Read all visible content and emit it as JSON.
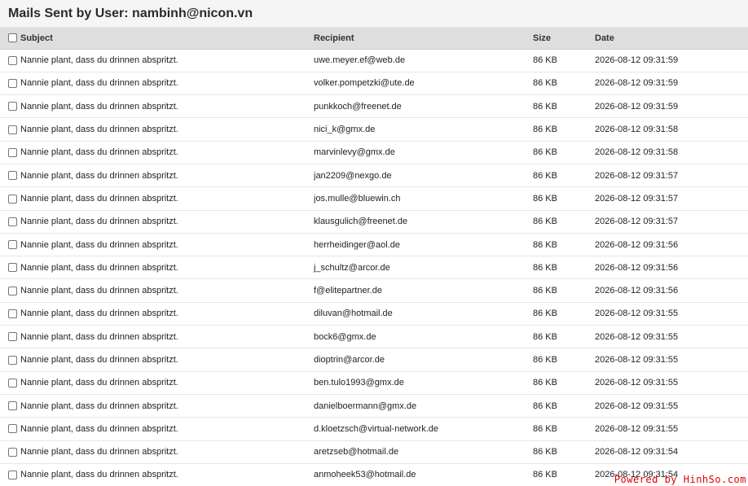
{
  "page": {
    "title": "Mails Sent by User: nambinh@nicon.vn"
  },
  "table": {
    "headers": {
      "subject": "Subject",
      "recipient": "Recipient",
      "size": "Size",
      "date": "Date"
    },
    "rows": [
      {
        "subject": "Nannie plant, dass du drinnen abspritzt.",
        "recipient": "uwe.meyer.ef@web.de",
        "size": "86 KB",
        "date": "2026-08-12 09:31:59"
      },
      {
        "subject": "Nannie plant, dass du drinnen abspritzt.",
        "recipient": "volker.pompetzki@ute.de",
        "size": "86 KB",
        "date": "2026-08-12 09:31:59"
      },
      {
        "subject": "Nannie plant, dass du drinnen abspritzt.",
        "recipient": "punkkoch@freenet.de",
        "size": "86 KB",
        "date": "2026-08-12 09:31:59"
      },
      {
        "subject": "Nannie plant, dass du drinnen abspritzt.",
        "recipient": "nici_k@gmx.de",
        "size": "86 KB",
        "date": "2026-08-12 09:31:58"
      },
      {
        "subject": "Nannie plant, dass du drinnen abspritzt.",
        "recipient": "marvinlevy@gmx.de",
        "size": "86 KB",
        "date": "2026-08-12 09:31:58"
      },
      {
        "subject": "Nannie plant, dass du drinnen abspritzt.",
        "recipient": "jan2209@nexgo.de",
        "size": "86 KB",
        "date": "2026-08-12 09:31:57"
      },
      {
        "subject": "Nannie plant, dass du drinnen abspritzt.",
        "recipient": "jos.mulle@bluewin.ch",
        "size": "86 KB",
        "date": "2026-08-12 09:31:57"
      },
      {
        "subject": "Nannie plant, dass du drinnen abspritzt.",
        "recipient": "klausgulich@freenet.de",
        "size": "86 KB",
        "date": "2026-08-12 09:31:57"
      },
      {
        "subject": "Nannie plant, dass du drinnen abspritzt.",
        "recipient": "herrheidinger@aol.de",
        "size": "86 KB",
        "date": "2026-08-12 09:31:56"
      },
      {
        "subject": "Nannie plant, dass du drinnen abspritzt.",
        "recipient": "j_schultz@arcor.de",
        "size": "86 KB",
        "date": "2026-08-12 09:31:56"
      },
      {
        "subject": "Nannie plant, dass du drinnen abspritzt.",
        "recipient": "f@elitepartner.de",
        "size": "86 KB",
        "date": "2026-08-12 09:31:56"
      },
      {
        "subject": "Nannie plant, dass du drinnen abspritzt.",
        "recipient": "diluvan@hotmail.de",
        "size": "86 KB",
        "date": "2026-08-12 09:31:55"
      },
      {
        "subject": "Nannie plant, dass du drinnen abspritzt.",
        "recipient": "bock6@gmx.de",
        "size": "86 KB",
        "date": "2026-08-12 09:31:55"
      },
      {
        "subject": "Nannie plant, dass du drinnen abspritzt.",
        "recipient": "dioptrin@arcor.de",
        "size": "86 KB",
        "date": "2026-08-12 09:31:55"
      },
      {
        "subject": "Nannie plant, dass du drinnen abspritzt.",
        "recipient": "ben.tulo1993@gmx.de",
        "size": "86 KB",
        "date": "2026-08-12 09:31:55"
      },
      {
        "subject": "Nannie plant, dass du drinnen abspritzt.",
        "recipient": "danielboermann@gmx.de",
        "size": "86 KB",
        "date": "2026-08-12 09:31:55"
      },
      {
        "subject": "Nannie plant, dass du drinnen abspritzt.",
        "recipient": "d.kloetzsch@virtual-network.de",
        "size": "86 KB",
        "date": "2026-08-12 09:31:55"
      },
      {
        "subject": "Nannie plant, dass du drinnen abspritzt.",
        "recipient": "aretzseb@hotmail.de",
        "size": "86 KB",
        "date": "2026-08-12 09:31:54"
      },
      {
        "subject": "Nannie plant, dass du drinnen abspritzt.",
        "recipient": "anmoheek53@hotmail.de",
        "size": "86 KB",
        "date": "2026-08-12 09:31:54"
      }
    ]
  },
  "footer": {
    "brand": "Powered by HinhSo.com",
    "brand_color": "#e00000"
  }
}
